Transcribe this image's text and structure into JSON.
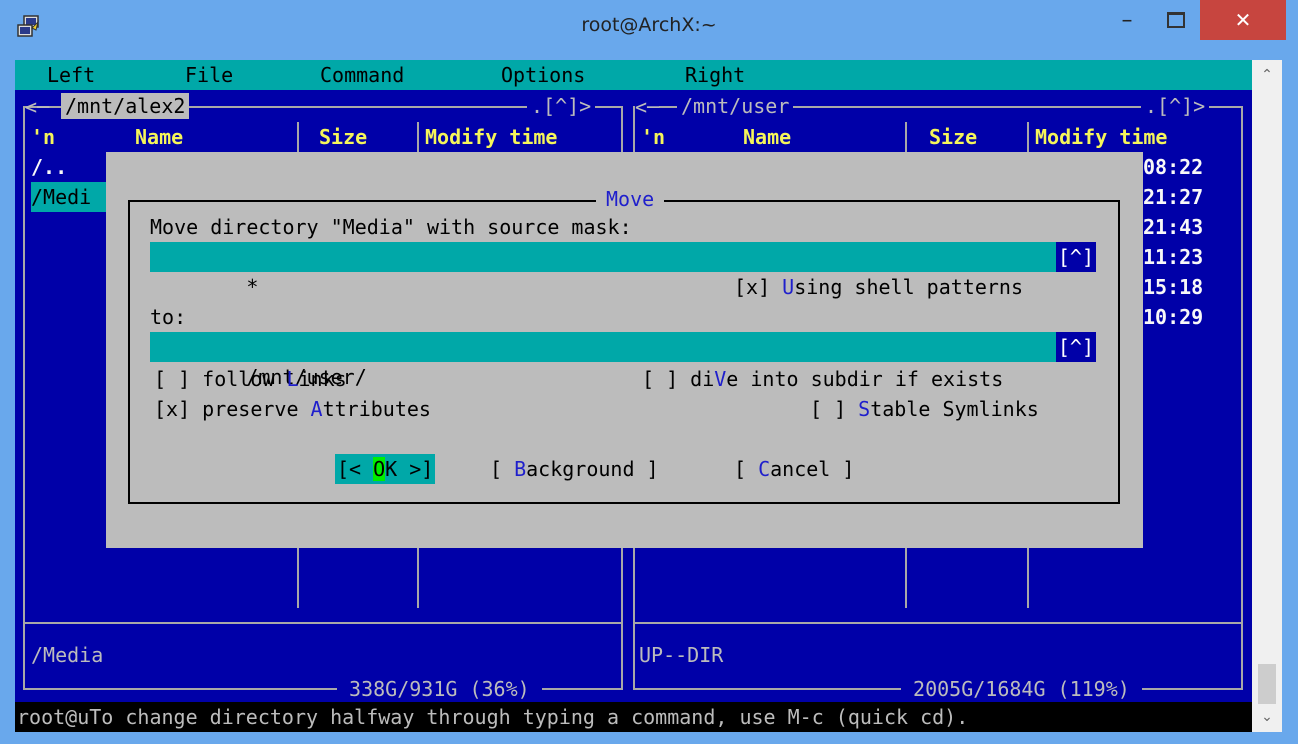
{
  "window": {
    "title": "root@ArchX:~",
    "minimize": "–",
    "close": "✕",
    "colors": {
      "titlebar": "#69a8ec",
      "close": "#c7453f",
      "terminal_bg": "#0000a8",
      "accent": "#00a8a8"
    }
  },
  "menu": [
    "Left",
    "File",
    "Command",
    "Options",
    "Right"
  ],
  "left_panel": {
    "path": " /mnt/alex2 ",
    "corner": ".[^]>",
    "headers": {
      "sort": "'n",
      "name": "Name",
      "size": "Size",
      "mtime": "Modify time"
    },
    "rows": [
      "/..",
      "/Medi"
    ],
    "mini_status": "/Media",
    "disk": " 338G/931G (36%) "
  },
  "right_panel": {
    "path": " /mnt/user ",
    "corner": ".[^]>",
    "headers": {
      "sort": "'n",
      "name": "Name",
      "size": "Size",
      "mtime": "Modify time"
    },
    "times": [
      "08:22",
      "21:27",
      "21:43",
      "11:23",
      "15:18",
      "10:29"
    ],
    "mini_status": "UP--DIR",
    "disk": " 2005G/1684G (119%) "
  },
  "dialog": {
    "title": "Move",
    "source_label": "Move directory \"Media\" with source mask:",
    "source_value": "*",
    "history_btn": "[^]",
    "shell_patterns": {
      "prefix": "[x] ",
      "hot": "U",
      "rest": "sing shell patterns"
    },
    "to_label": "to:",
    "to_value": "/mnt/user/",
    "follow_links": {
      "prefix": "[ ] follow ",
      "hot": "L",
      "rest": "inks"
    },
    "dive": {
      "prefix": "[ ] di",
      "hot": "V",
      "rest": "e into subdir if exists"
    },
    "preserve": {
      "prefix": "[x] preserve ",
      "hot": "A",
      "rest": "ttributes"
    },
    "stable": {
      "prefix": "[ ] ",
      "hot": "S",
      "rest": "table Symlinks"
    },
    "ok": {
      "pre": "[< ",
      "hot": "O",
      "post": "K >]"
    },
    "background": {
      "pre": "[ ",
      "hot": "B",
      "post": "ackground ]"
    },
    "cancel": {
      "pre": "[ ",
      "hot": "C",
      "post": "ancel ]"
    }
  },
  "hint": "root@uTo change directory halfway through typing a command, use M-c (quick cd)."
}
